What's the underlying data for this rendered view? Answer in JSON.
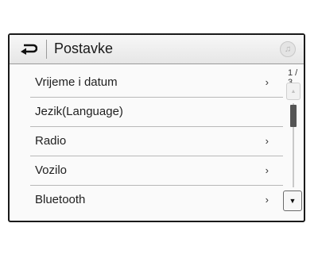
{
  "header": {
    "title": "Postavke",
    "back_icon": "return-arrow-icon",
    "media_icon": "music-note-icon"
  },
  "menu": {
    "items": [
      {
        "label": "Vrijeme i datum",
        "has_submenu": true
      },
      {
        "label": "Jezik(Language)",
        "has_submenu": false
      },
      {
        "label": "Radio",
        "has_submenu": true
      },
      {
        "label": "Vozilo",
        "has_submenu": true
      },
      {
        "label": "Bluetooth",
        "has_submenu": true
      }
    ],
    "arrow_glyph": "›"
  },
  "scroll": {
    "page_indicator": "1 / 3",
    "up_icon": "triangle-up-icon",
    "down_icon": "triangle-down-icon"
  }
}
